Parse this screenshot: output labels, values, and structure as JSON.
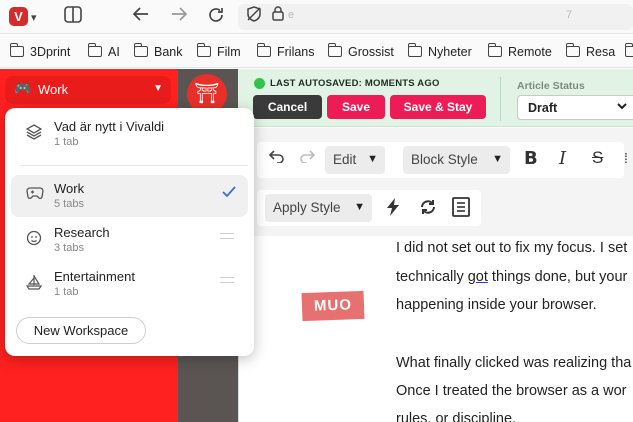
{
  "browser": {
    "logo": "V",
    "icons": {
      "menu": "chevron-down-icon",
      "panel": "panel-toggle-icon",
      "back": "back-arrow-icon",
      "forward": "forward-arrow-icon",
      "reload": "reload-icon",
      "tracker": "tracker-blocker-icon",
      "lock": "lock-icon"
    },
    "address_text": "e",
    "address_suffix": "7"
  },
  "bookmarks": [
    "3Dprint",
    "AI",
    "Bank",
    "Film",
    "Frilans",
    "Grossist",
    "Nyheter",
    "Remote",
    "Resa"
  ],
  "workspace_button": {
    "label": "Work"
  },
  "workspace_menu": {
    "top_item": {
      "name": "Vad är nytt i Vivaldi",
      "count": "1 tab"
    },
    "items": [
      {
        "name": "Work",
        "count": "5 tabs",
        "icon": "gamepad-icon",
        "active": true
      },
      {
        "name": "Research",
        "count": "3 tabs",
        "icon": "face-icon",
        "active": false
      },
      {
        "name": "Entertainment",
        "count": "1 tab",
        "icon": "sailboat-icon",
        "active": false
      }
    ],
    "new_button": "New Workspace"
  },
  "cms": {
    "autosave": "LAST AUTOSAVED:  MOMENTS AGO",
    "buttons": {
      "cancel": "Cancel",
      "save": "Save",
      "save_stay": "Save & Stay"
    },
    "status_label": "Article Status",
    "status_value": "Draft",
    "toolbar": {
      "edit": "Edit",
      "block_style": "Block Style",
      "apply_style": "Apply Style"
    },
    "content_lines": [
      "I did not set out to fix my focus. I set",
      "happening inside your browser.",
      "What finally clicked was realizing tha",
      "Once I treated the browser as a wor",
      "rules, or discipline."
    ],
    "line2_pre": "technically ",
    "line2_link": "got",
    "line2_post": " things done, but your",
    "watermark": "MUO"
  },
  "colors": {
    "sidebar_red": "#ff2020",
    "accent_pink": "#ed1c56",
    "autosave_green": "#2ec54a",
    "check_blue": "#3a6fd8"
  }
}
